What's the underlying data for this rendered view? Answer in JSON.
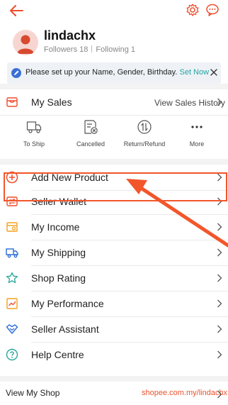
{
  "header": {
    "back_icon": "arrow-left-icon",
    "settings_icon": "gear-icon",
    "chat_icon": "chat-icon",
    "accent": "#ee4d2d"
  },
  "profile": {
    "username": "lindachx",
    "followers": "Followers 18",
    "following": "Following 1"
  },
  "notice": {
    "message": "Please set up your Name, Gender, Birthday.",
    "link": "Set Now"
  },
  "sales": {
    "title": "My Sales",
    "history": "View Sales History",
    "statuses": [
      {
        "label": "To Ship",
        "icon": "truck-icon"
      },
      {
        "label": "Cancelled",
        "icon": "cancelled-icon"
      },
      {
        "label": "Return/Refund",
        "icon": "refund-icon"
      },
      {
        "label": "More",
        "icon": "more-icon"
      }
    ]
  },
  "menu": [
    {
      "label": "Add New Product",
      "icon": "plus-circle-icon"
    },
    {
      "label": "Seller Wallet",
      "icon": "wallet-icon"
    },
    {
      "label": "My Income",
      "icon": "income-icon"
    },
    {
      "label": "My Shipping",
      "icon": "shipping-truck-icon"
    },
    {
      "label": "Shop Rating",
      "icon": "star-icon"
    },
    {
      "label": "My Performance",
      "icon": "performance-icon"
    },
    {
      "label": "Seller Assistant",
      "icon": "handshake-icon"
    },
    {
      "label": "Help Centre",
      "icon": "help-icon"
    }
  ],
  "footer": {
    "label": "View My Shop",
    "link": "shopee.com.my/lindachx"
  },
  "annotation": {
    "color": "#f2562b"
  }
}
